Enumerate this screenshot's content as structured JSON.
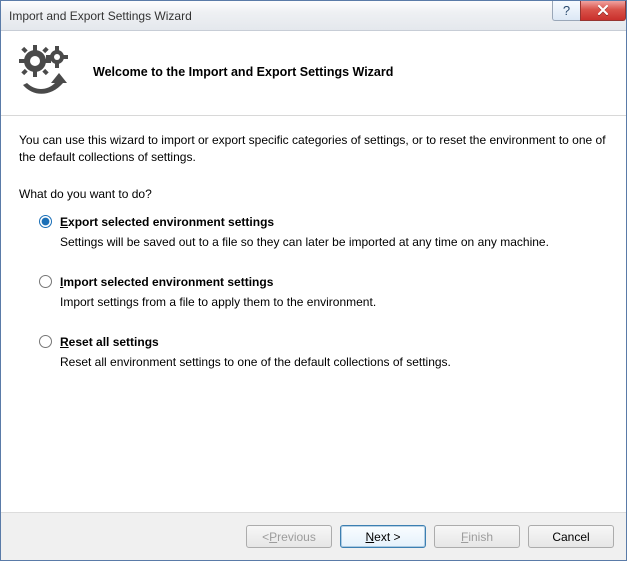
{
  "window": {
    "title": "Import and Export Settings Wizard"
  },
  "header": {
    "title": "Welcome to the Import and Export Settings Wizard"
  },
  "body": {
    "intro": "You can use this wizard to import or export specific categories of settings, or to reset the environment to one of the default collections of settings.",
    "prompt": "What do you want to do?"
  },
  "options": {
    "export": {
      "mnemonic": "E",
      "label_rest": "xport selected environment settings",
      "desc": "Settings will be saved out to a file so they can later be imported at any time on any machine.",
      "checked": true
    },
    "import": {
      "mnemonic": "I",
      "label_rest": "mport selected environment settings",
      "desc": "Import settings from a file to apply them to the environment.",
      "checked": false
    },
    "reset": {
      "mnemonic": "R",
      "label_rest": "eset all settings",
      "desc": "Reset all environment settings to one of the default collections of settings.",
      "checked": false
    }
  },
  "footer": {
    "previous_pre": "< ",
    "previous_mn": "P",
    "previous_post": "revious",
    "next_mn": "N",
    "next_post": "ext >",
    "finish_mn": "F",
    "finish_post": "inish",
    "cancel": "Cancel"
  }
}
